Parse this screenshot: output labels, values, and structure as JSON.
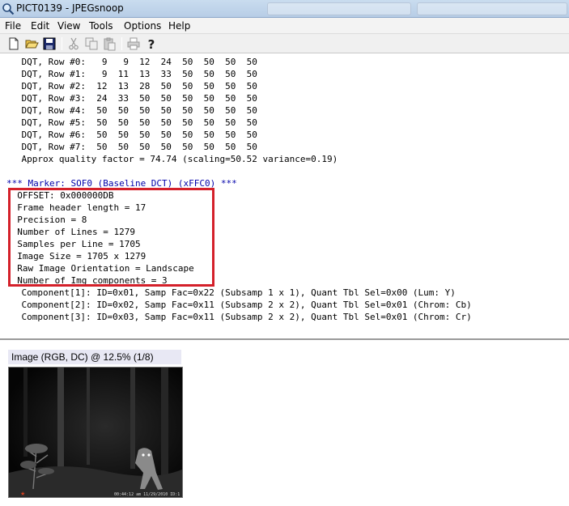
{
  "window": {
    "title": "PICT0139 - JPEGsnoop"
  },
  "menu": [
    "File",
    "Edit",
    "View",
    "Tools",
    "Options",
    "Help"
  ],
  "toolbar": {
    "buttons": [
      "new-icon",
      "open-icon",
      "save-icon",
      "cut-icon",
      "copy-icon",
      "paste-icon",
      "print-icon",
      "help-icon"
    ]
  },
  "log": {
    "dqt_rows": [
      "    DQT, Row #0:   9   9  12  24  50  50  50  50",
      "    DQT, Row #1:   9  11  13  33  50  50  50  50",
      "    DQT, Row #2:  12  13  28  50  50  50  50  50",
      "    DQT, Row #3:  24  33  50  50  50  50  50  50",
      "    DQT, Row #4:  50  50  50  50  50  50  50  50",
      "    DQT, Row #5:  50  50  50  50  50  50  50  50",
      "    DQT, Row #6:  50  50  50  50  50  50  50  50",
      "    DQT, Row #7:  50  50  50  50  50  50  50  50"
    ],
    "quality": "    Approx quality factor = 74.74 (scaling=50.52 variance=0.19)",
    "marker": "*** Marker: SOF0 (Baseline DCT) (xFFC0) ***",
    "sof_lines": [
      "  OFFSET: 0x000000DB",
      "  Frame header length = 17",
      "  Precision = 8",
      "  Number of Lines = 1279",
      "  Samples per Line = 1705",
      "  Image Size = 1705 x 1279",
      "  Raw Image Orientation = Landscape",
      "  Number of Img components = 3"
    ],
    "components": [
      "    Component[1]: ID=0x01, Samp Fac=0x22 (Subsamp 1 x 1), Quant Tbl Sel=0x00 (Lum: Y)",
      "    Component[2]: ID=0x02, Samp Fac=0x11 (Subsamp 2 x 2), Quant Tbl Sel=0x01 (Chrom: Cb)",
      "    Component[3]: ID=0x03, Samp Fac=0x11 (Subsamp 2 x 2), Quant Tbl Sel=0x01 (Chrom: Cr)"
    ]
  },
  "image_pane": {
    "caption": "Image (RGB, DC) @ 12.5% (1/8)",
    "photo_stamp": "00:44:12 am  11/29/2010  ID:1"
  },
  "colors": {
    "highlight_border": "#d4202a",
    "marker_text": "#0000aa"
  }
}
